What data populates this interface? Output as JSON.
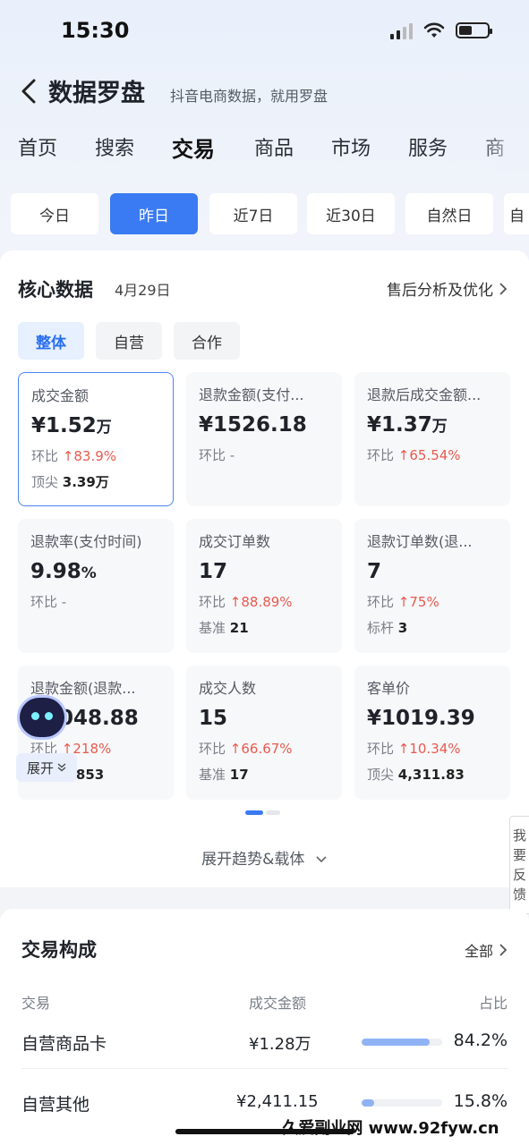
{
  "status": {
    "time": "15:30"
  },
  "header": {
    "title": "数据罗盘",
    "slogan": "抖音电商数据，就用罗盘"
  },
  "nav_tabs": [
    {
      "label": "首页"
    },
    {
      "label": "搜索"
    },
    {
      "label": "交易",
      "active": true
    },
    {
      "label": "商品"
    },
    {
      "label": "市场"
    },
    {
      "label": "服务"
    },
    {
      "label": "商"
    }
  ],
  "date_filters": [
    {
      "label": "今日"
    },
    {
      "label": "昨日",
      "active": true
    },
    {
      "label": "近7日"
    },
    {
      "label": "近30日"
    },
    {
      "label": "自然日"
    },
    {
      "label": "自"
    }
  ],
  "core": {
    "title": "核心数据",
    "date": "4月29日",
    "link": "售后分析及优化",
    "segments": [
      {
        "label": "整体",
        "active": true
      },
      {
        "label": "自营"
      },
      {
        "label": "合作"
      }
    ],
    "metrics": [
      {
        "label": "成交金额",
        "value": "¥1.52",
        "unit": "万",
        "compare_label": "环比",
        "compare": "↑83.9%",
        "extra_label": "顶尖",
        "extra": "3.39万"
      },
      {
        "label": "退款金额(支付...",
        "value": "¥1526.18",
        "unit": "",
        "compare_label": "环比",
        "compare": "-",
        "extra_label": "",
        "extra": ""
      },
      {
        "label": "退款后成交金额...",
        "value": "¥1.37",
        "unit": "万",
        "compare_label": "环比",
        "compare": "↑65.54%",
        "extra_label": "",
        "extra": ""
      },
      {
        "label": "退款率(支付时间)",
        "value": "9.98",
        "unit": "%",
        "compare_label": "环比",
        "compare": "-",
        "extra_label": "",
        "extra": ""
      },
      {
        "label": "成交订单数",
        "value": "17",
        "unit": "",
        "compare_label": "环比",
        "compare": "↑88.89%",
        "extra_label": "基准",
        "extra": "21"
      },
      {
        "label": "退款订单数(退...",
        "value": "7",
        "unit": "",
        "compare_label": "环比",
        "compare": "↑75%",
        "extra_label": "标杆",
        "extra": "3"
      },
      {
        "label": "退款金额(退款...",
        "value": "¥1048.88",
        "unit": "",
        "compare_label": "环比",
        "compare": "↑218%",
        "extra_label": "顶尖",
        "extra": "2,853"
      },
      {
        "label": "成交人数",
        "value": "15",
        "unit": "",
        "compare_label": "环比",
        "compare": "↑66.67%",
        "extra_label": "基准",
        "extra": "17"
      },
      {
        "label": "客单价",
        "value": "¥1019.39",
        "unit": "",
        "compare_label": "环比",
        "compare": "↑10.34%",
        "extra_label": "顶尖",
        "extra": "4,311.83"
      }
    ],
    "expand_label": "展开趋势&载体"
  },
  "assistant": {
    "expand_label": "展开"
  },
  "feedback": {
    "chars": [
      "我",
      "要",
      "反",
      "馈"
    ]
  },
  "composition": {
    "title": "交易构成",
    "all_label": "全部",
    "headers": {
      "type": "交易",
      "amount": "成交金额",
      "ratio": "占比"
    },
    "rows": [
      {
        "name": "自营商品卡",
        "amount": "¥1.28万",
        "ratio": "84.2%",
        "share": 0.842
      },
      {
        "name": "自营其他",
        "amount": "¥2,411.15",
        "ratio": "15.8%",
        "share": 0.158
      }
    ]
  },
  "watermark": "久爱副业网  www.92fyw.cn",
  "colors": {
    "accent": "#3a7af3",
    "up": "#e85a4f"
  }
}
